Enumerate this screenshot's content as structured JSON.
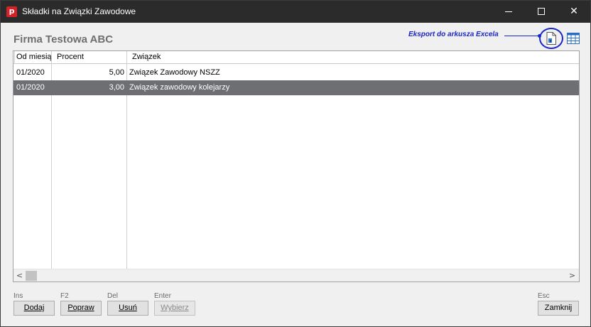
{
  "window": {
    "title": "Składki na Związki Zawodowe",
    "app_icon_letter": "p",
    "controls": {
      "minimize": "minimize",
      "maximize": "maximize",
      "close": "✕"
    }
  },
  "company_name": "Firma Testowa ABC",
  "export": {
    "label": "Eksport do arkusza Excela"
  },
  "table": {
    "headers": [
      "Od miesią",
      "Procent",
      "Związek"
    ],
    "rows": [
      {
        "month": "01/2020",
        "percent": "5,00",
        "union": "Związek Zawodowy NSZZ",
        "selected": false
      },
      {
        "month": "01/2020",
        "percent": "3,00",
        "union": "Związek zawodowy kolejarzy",
        "selected": true
      }
    ],
    "scroll_left": "<",
    "scroll_right": ">"
  },
  "footer": {
    "buttons": [
      {
        "hint": "Ins",
        "label": "Dodaj",
        "enabled": true
      },
      {
        "hint": "F2",
        "label": "Popraw",
        "enabled": true
      },
      {
        "hint": "Del",
        "label": "Usuń",
        "enabled": true
      },
      {
        "hint": "Enter",
        "label": "Wybierz",
        "enabled": false
      }
    ],
    "close": {
      "hint": "Esc",
      "label": "Zamknij"
    }
  },
  "colors": {
    "accent": "#1a28c8",
    "selection": "#6d6f73",
    "titlebar": "#2b2b2b",
    "app_icon": "#d4222a"
  }
}
